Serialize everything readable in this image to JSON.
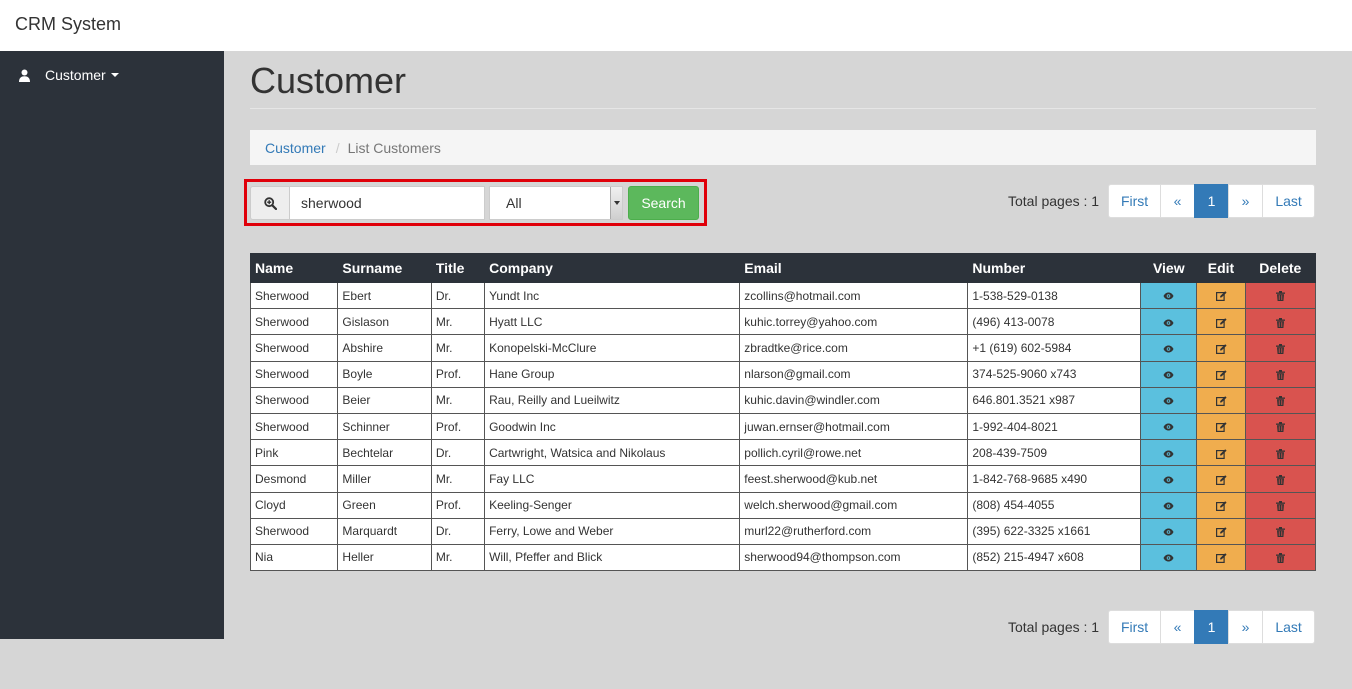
{
  "app": {
    "brand": "CRM System"
  },
  "sidebar": {
    "items": [
      {
        "label": "Customer",
        "icon": "user-icon"
      }
    ]
  },
  "page": {
    "title": "Customer"
  },
  "breadcrumb": {
    "link": "Customer",
    "separator": "/",
    "active": "List Customers"
  },
  "search": {
    "value": "sherwood",
    "filter_selected": "All",
    "button_label": "Search",
    "highlight_color": "#e0000a"
  },
  "pagination_top": {
    "total_label": "Total pages : 1",
    "first": "First",
    "prev": "«",
    "current": "1",
    "next": "»",
    "last": "Last"
  },
  "pagination_bottom": {
    "total_label": "Total pages : 1",
    "first": "First",
    "prev": "«",
    "current": "1",
    "next": "»",
    "last": "Last"
  },
  "table": {
    "columns": [
      "Name",
      "Surname",
      "Title",
      "Company",
      "Email",
      "Number",
      "View",
      "Edit",
      "Delete"
    ],
    "rows": [
      [
        "Sherwood",
        "Ebert",
        "Dr.",
        "Yundt Inc",
        "zcollins@hotmail.com",
        "1-538-529-0138"
      ],
      [
        "Sherwood",
        "Gislason",
        "Mr.",
        "Hyatt LLC",
        "kuhic.torrey@yahoo.com",
        "(496) 413-0078"
      ],
      [
        "Sherwood",
        "Abshire",
        "Mr.",
        "Konopelski-McClure",
        "zbradtke@rice.com",
        "+1 (619) 602-5984"
      ],
      [
        "Sherwood",
        "Boyle",
        "Prof.",
        "Hane Group",
        "nlarson@gmail.com",
        "374-525-9060 x743"
      ],
      [
        "Sherwood",
        "Beier",
        "Mr.",
        "Rau, Reilly and Lueilwitz",
        "kuhic.davin@windler.com",
        "646.801.3521 x987"
      ],
      [
        "Sherwood",
        "Schinner",
        "Prof.",
        "Goodwin Inc",
        "juwan.ernser@hotmail.com",
        "1-992-404-8021"
      ],
      [
        "Pink",
        "Bechtelar",
        "Dr.",
        "Cartwright, Watsica and Nikolaus",
        "pollich.cyril@rowe.net",
        "208-439-7509"
      ],
      [
        "Desmond",
        "Miller",
        "Mr.",
        "Fay LLC",
        "feest.sherwood@kub.net",
        "1-842-768-9685 x490"
      ],
      [
        "Cloyd",
        "Green",
        "Prof.",
        "Keeling-Senger",
        "welch.sherwood@gmail.com",
        "(808) 454-4055"
      ],
      [
        "Sherwood",
        "Marquardt",
        "Dr.",
        "Ferry, Lowe and Weber",
        "murl22@rutherford.com",
        "(395) 622-3325 x1661"
      ],
      [
        "Nia",
        "Heller",
        "Mr.",
        "Will, Pfeffer and Blick",
        "sherwood94@thompson.com",
        "(852) 215-4947 x608"
      ]
    ],
    "actions": {
      "view_icon": "eye-icon",
      "edit_icon": "edit-icon",
      "delete_icon": "trash-icon"
    }
  }
}
